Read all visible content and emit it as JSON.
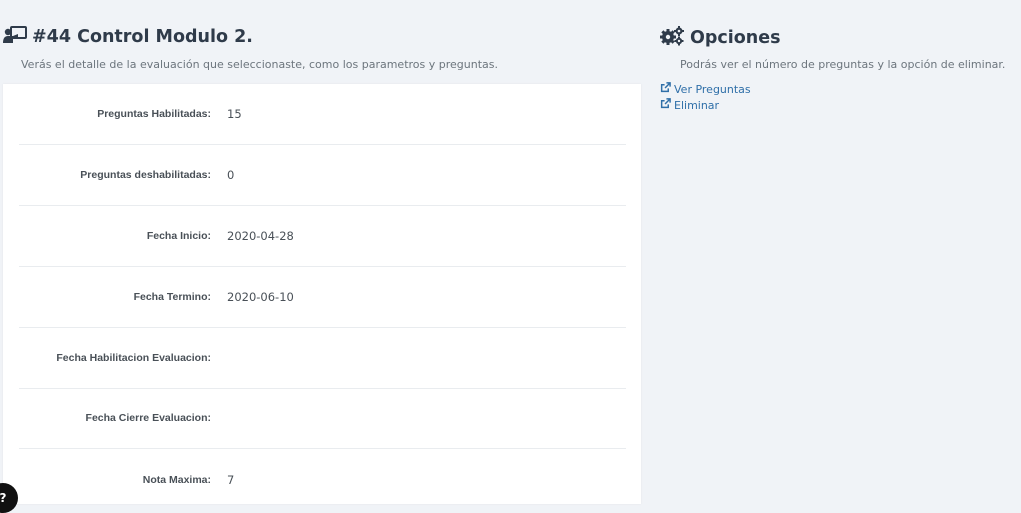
{
  "evaluation": {
    "title": "#44 Control Modulo 2.",
    "subtitle": "Verás el detalle de la evaluación que seleccionaste, como los parametros y preguntas.",
    "fields": [
      {
        "label": "Preguntas Habilitadas:",
        "value": "15"
      },
      {
        "label": "Preguntas deshabilitadas:",
        "value": "0"
      },
      {
        "label": "Fecha Inicio:",
        "value": "2020-04-28"
      },
      {
        "label": "Fecha Termino:",
        "value": "2020-06-10"
      },
      {
        "label": "Fecha Habilitacion Evaluacion:",
        "value": ""
      },
      {
        "label": "Fecha Cierre Evaluacion:",
        "value": ""
      },
      {
        "label": "Nota Maxima:",
        "value": "7"
      }
    ]
  },
  "options": {
    "title": "Opciones",
    "subtitle": "Podrás ver el número de preguntas y la opción de eliminar.",
    "links": [
      {
        "label": "Ver Preguntas",
        "icon": "external-link-icon"
      },
      {
        "label": "Eliminar",
        "icon": "external-link-icon"
      }
    ]
  },
  "colors": {
    "background": "#f0f3f7",
    "card": "#ffffff",
    "link": "#2f6fa8",
    "heading": "#2f3b4a"
  }
}
